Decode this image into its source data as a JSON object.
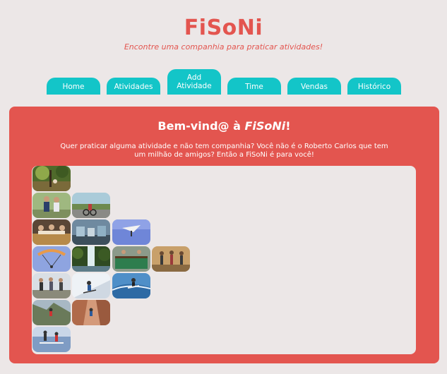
{
  "header": {
    "title": "FiSoNi",
    "subtitle": "Encontre uma companhia para praticar atividades!"
  },
  "nav": {
    "tabs": [
      {
        "label": "Home"
      },
      {
        "label": "Atividades"
      },
      {
        "label": "Add Atividade",
        "active": true
      },
      {
        "label": "Time"
      },
      {
        "label": "Vendas"
      },
      {
        "label": "Histórico"
      }
    ]
  },
  "main": {
    "welcome_prefix": "Bem-vind@ à ",
    "welcome_brand": "FiSoNi",
    "welcome_suffix": "!",
    "intro": "Quer praticar alguma atividade e não tem companhia? Você não é o Roberto Carlos que tem um milhão de amigos? Então a FiSoNi é para você!"
  },
  "colors": {
    "accent": "#e3554f",
    "tab": "#13c5c8",
    "background": "#ece7e7"
  },
  "gallery": {
    "rows": [
      [
        {
          "name": "photo-forest-trail-icon"
        }
      ],
      [
        {
          "name": "photo-couple-jogging-icon"
        },
        {
          "name": "photo-cycling-icon"
        }
      ],
      [
        {
          "name": "photo-cooking-class-icon"
        },
        {
          "name": "photo-gym-icon"
        },
        {
          "name": "photo-hang-gliding-icon"
        }
      ],
      [
        {
          "name": "photo-paragliding-icon"
        },
        {
          "name": "photo-waterfall-icon"
        },
        {
          "name": "photo-pool-table-icon"
        },
        {
          "name": "photo-dance-class-icon"
        }
      ],
      [
        {
          "name": "photo-group-hiking-icon"
        },
        {
          "name": "photo-skiing-icon"
        },
        {
          "name": "photo-surfing-icon"
        }
      ],
      [
        {
          "name": "photo-rock-climbing-icon"
        },
        {
          "name": "photo-canyon-climbing-icon"
        }
      ],
      [
        {
          "name": "photo-stand-up-paddle-icon"
        }
      ]
    ]
  }
}
